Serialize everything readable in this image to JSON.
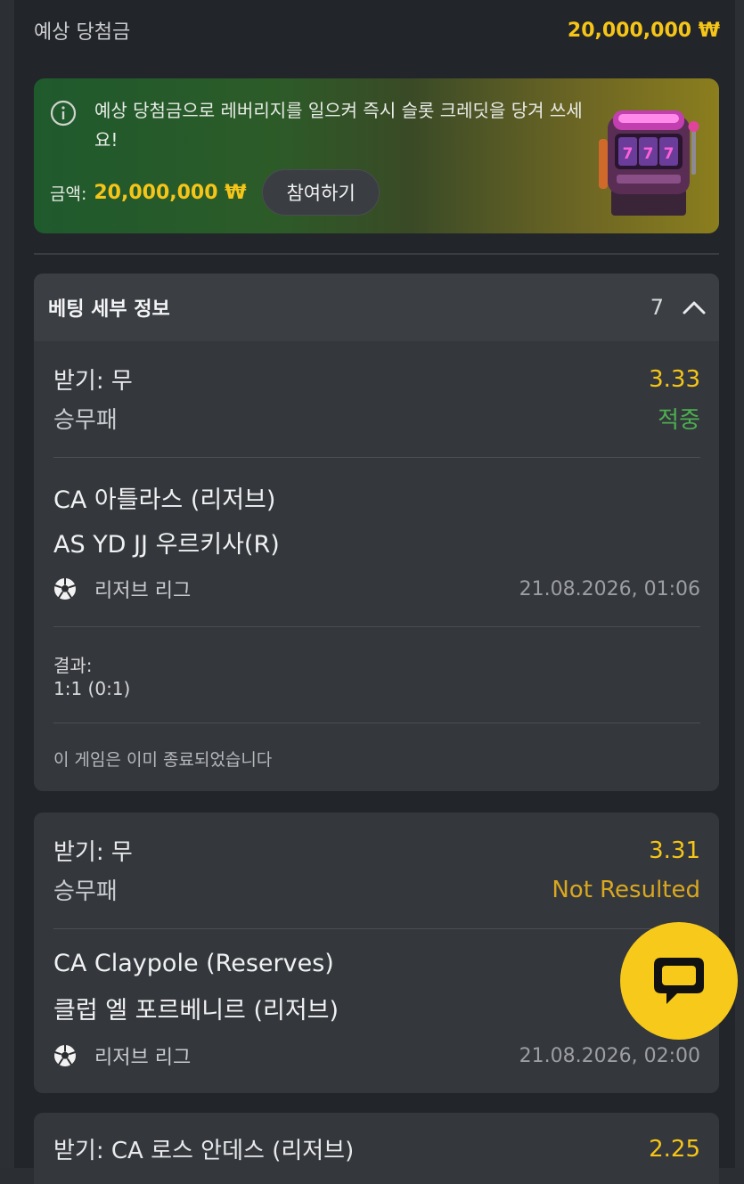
{
  "payout": {
    "label": "예상 당첨금",
    "value": "20,000,000 ₩"
  },
  "promo": {
    "message": "예상 당첨금으로 레버리지를 일으켜 즉시 슬롯 크레딧을 당겨 쓰세요!",
    "amount_label": "금액:",
    "amount": "20,000,000 ₩",
    "join_label": "참여하기",
    "slot_text": "777"
  },
  "details": {
    "title": "베팅 세부 정보",
    "count": "7"
  },
  "bets": [
    {
      "pick": "받기: 무",
      "odds": "3.33",
      "market": "승무패",
      "status": "적중",
      "team1": "CA 아틀라스 (리저브)",
      "team2": "AS YD JJ 우르키사(R)",
      "league": "리저브 리그",
      "datetime": "21.08.2026, 01:06",
      "result_label": "결과:",
      "result_score": "1:1 (0:1)",
      "note": "이 게임은 이미 종료되었습니다"
    },
    {
      "pick": "받기: 무",
      "odds": "3.31",
      "market": "승무패",
      "status": "Not Resulted",
      "team1": "CA Claypole (Reserves)",
      "team2": "클럽 엘 포르베니르 (리저브)",
      "league": "리저브 리그",
      "datetime": "21.08.2026, 02:00"
    },
    {
      "pick": "받기: CA 로스 안데스 (리저브)",
      "odds": "2.25"
    }
  ],
  "colors": {
    "accent": "#f5c518",
    "won": "#4caf50",
    "pending": "#d9a820",
    "chat": "#f7c91b"
  },
  "icons": {
    "info": "info-icon",
    "collapse": "chevron-up-icon",
    "sport": "soccer-ball-icon",
    "chat": "chat-bubble-icon"
  }
}
